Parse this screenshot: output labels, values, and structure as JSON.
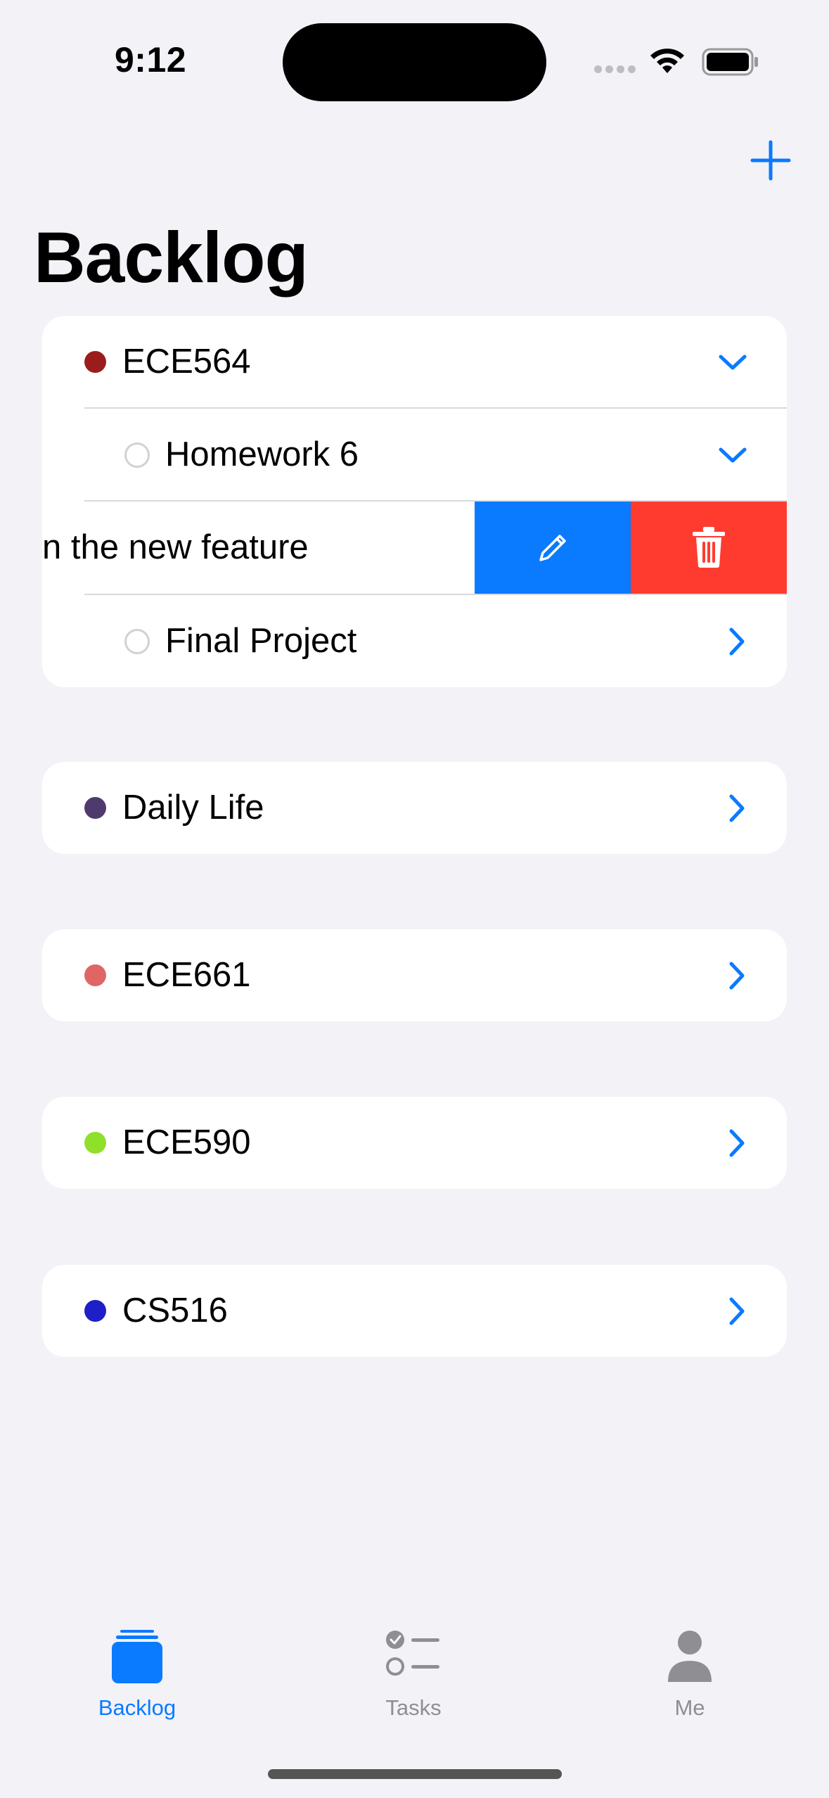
{
  "status": {
    "time": "9:12"
  },
  "header": {
    "title": "Backlog",
    "add_icon": "plus-icon"
  },
  "colors": {
    "accent": "#0A7AFF",
    "delete": "#FF3B30",
    "inactive": "#8E8E93"
  },
  "groups": [
    {
      "name": "ECE564",
      "color": "#9B1C1C",
      "expanded": true,
      "items": [
        {
          "label": "Homework 6",
          "expanded": true
        },
        {
          "label": "n the new feature",
          "swiped": true,
          "actions": [
            "pencil-icon",
            "trash-icon"
          ]
        },
        {
          "label": "Final Project",
          "expanded": false
        }
      ]
    },
    {
      "name": "Daily Life",
      "color": "#4F3A6E"
    },
    {
      "name": "ECE661",
      "color": "#E06666"
    },
    {
      "name": "ECE590",
      "color": "#8FE02A"
    },
    {
      "name": "CS516",
      "color": "#1F1FC8"
    }
  ],
  "tabbar": {
    "items": [
      {
        "label": "Backlog",
        "icon": "stack-icon",
        "active": true
      },
      {
        "label": "Tasks",
        "icon": "checklist-icon",
        "active": false
      },
      {
        "label": "Me",
        "icon": "person-icon",
        "active": false
      }
    ]
  }
}
